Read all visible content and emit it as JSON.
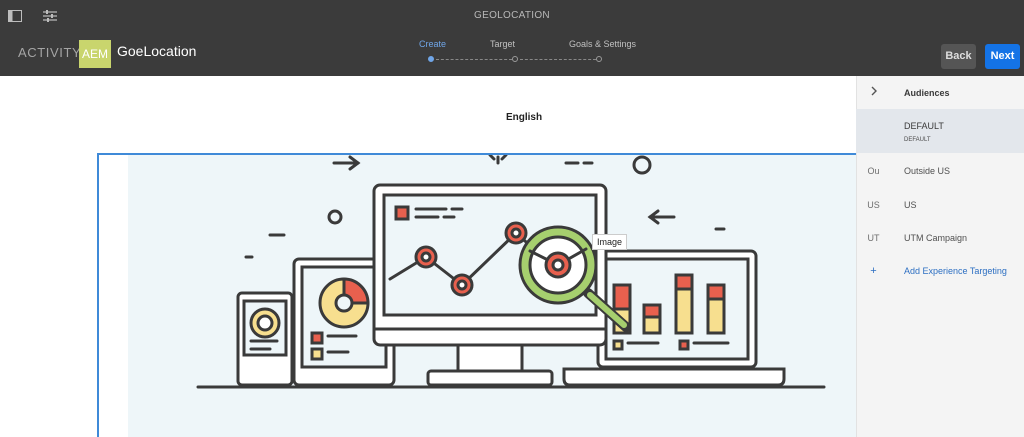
{
  "window": {
    "title": "GEOLOCATION"
  },
  "header": {
    "activity_label": "ACTIVITY",
    "badge": "AEM",
    "activity_name": "GoeLocation",
    "back_label": "Back",
    "next_label": "Next"
  },
  "steps": [
    {
      "label": "Create",
      "active": true
    },
    {
      "label": "Target",
      "active": false
    },
    {
      "label": "Goals & Settings",
      "active": false
    }
  ],
  "canvas": {
    "language": "English",
    "image_tooltip": "Image"
  },
  "panel": {
    "collapse_icon": "chevron-right-icon",
    "title": "Audiences",
    "items": [
      {
        "rail": "",
        "label": "DEFAULT",
        "sub": "DEFAULT",
        "selected": true
      },
      {
        "rail": "Ou",
        "label": "Outside US"
      },
      {
        "rail": "US",
        "label": "US"
      },
      {
        "rail": "UT",
        "label": "UTM Campaign"
      }
    ],
    "add": {
      "rail": "+",
      "label": "Add Experience Targeting"
    }
  },
  "colors": {
    "accent": "#1473e6",
    "badge": "#c9d56d",
    "topbar": "#3b3b3b",
    "illustration_red": "#e8604e",
    "illustration_green": "#a6cf6e",
    "illustration_yellow": "#f7df8f"
  },
  "icons": {
    "sidebar_toggle": "sidebar-toggle-icon",
    "properties": "sliders-icon"
  }
}
